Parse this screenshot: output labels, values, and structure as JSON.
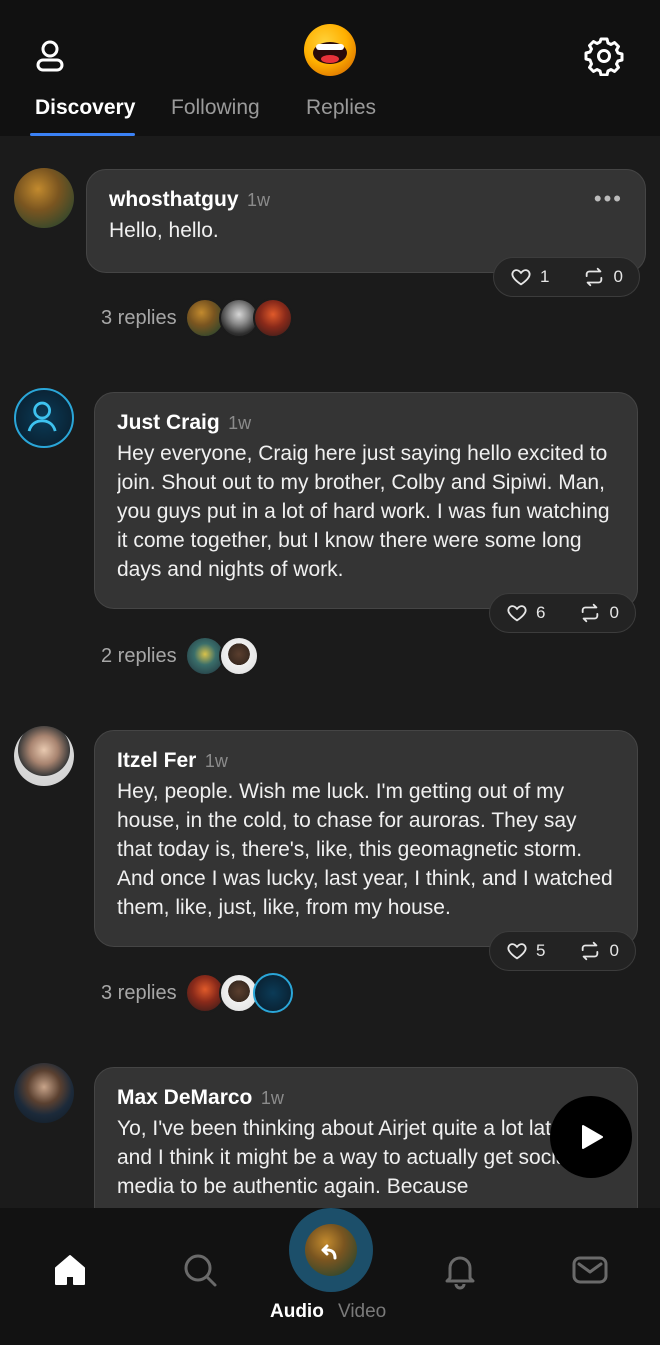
{
  "header": {
    "tabs": [
      {
        "label": "Discovery",
        "active": true
      },
      {
        "label": "Following",
        "active": false
      },
      {
        "label": "Replies",
        "active": false
      }
    ],
    "accent_color": "#3b82f6"
  },
  "posts": [
    {
      "author": "whosthatguy",
      "time": "1w",
      "text": "Hello, hello.",
      "likes": "1",
      "reposts": "0",
      "replies_label": "3 replies",
      "has_more_menu": true
    },
    {
      "author": "Just Craig",
      "time": "1w",
      "text": "Hey everyone, Craig here just saying hello excited to join. Shout out to my brother, Colby and Sipiwi. Man, you guys put in a lot of hard work. I was fun watching it come together, but I know there were some long days and nights of work.",
      "likes": "6",
      "reposts": "0",
      "replies_label": "2 replies"
    },
    {
      "author": "Itzel Fer",
      "time": "1w",
      "text": "Hey, people. Wish me luck. I'm getting out of my house, in the cold, to chase for auroras. They say that today is, there's, like, this geomagnetic storm. And once I was lucky, last year, I think, and I watched them, like, just, like, from my house.",
      "likes": "5",
      "reposts": "0",
      "replies_label": "3 replies"
    },
    {
      "author": "Max DeMarco",
      "time": "1w",
      "text": "Yo, I've been thinking about Airjet quite a lot lately and I think it might be a way to actually get social media to be authentic again. Because"
    }
  ],
  "bottom_nav": {
    "audio_label": "Audio",
    "video_label": "Video"
  }
}
